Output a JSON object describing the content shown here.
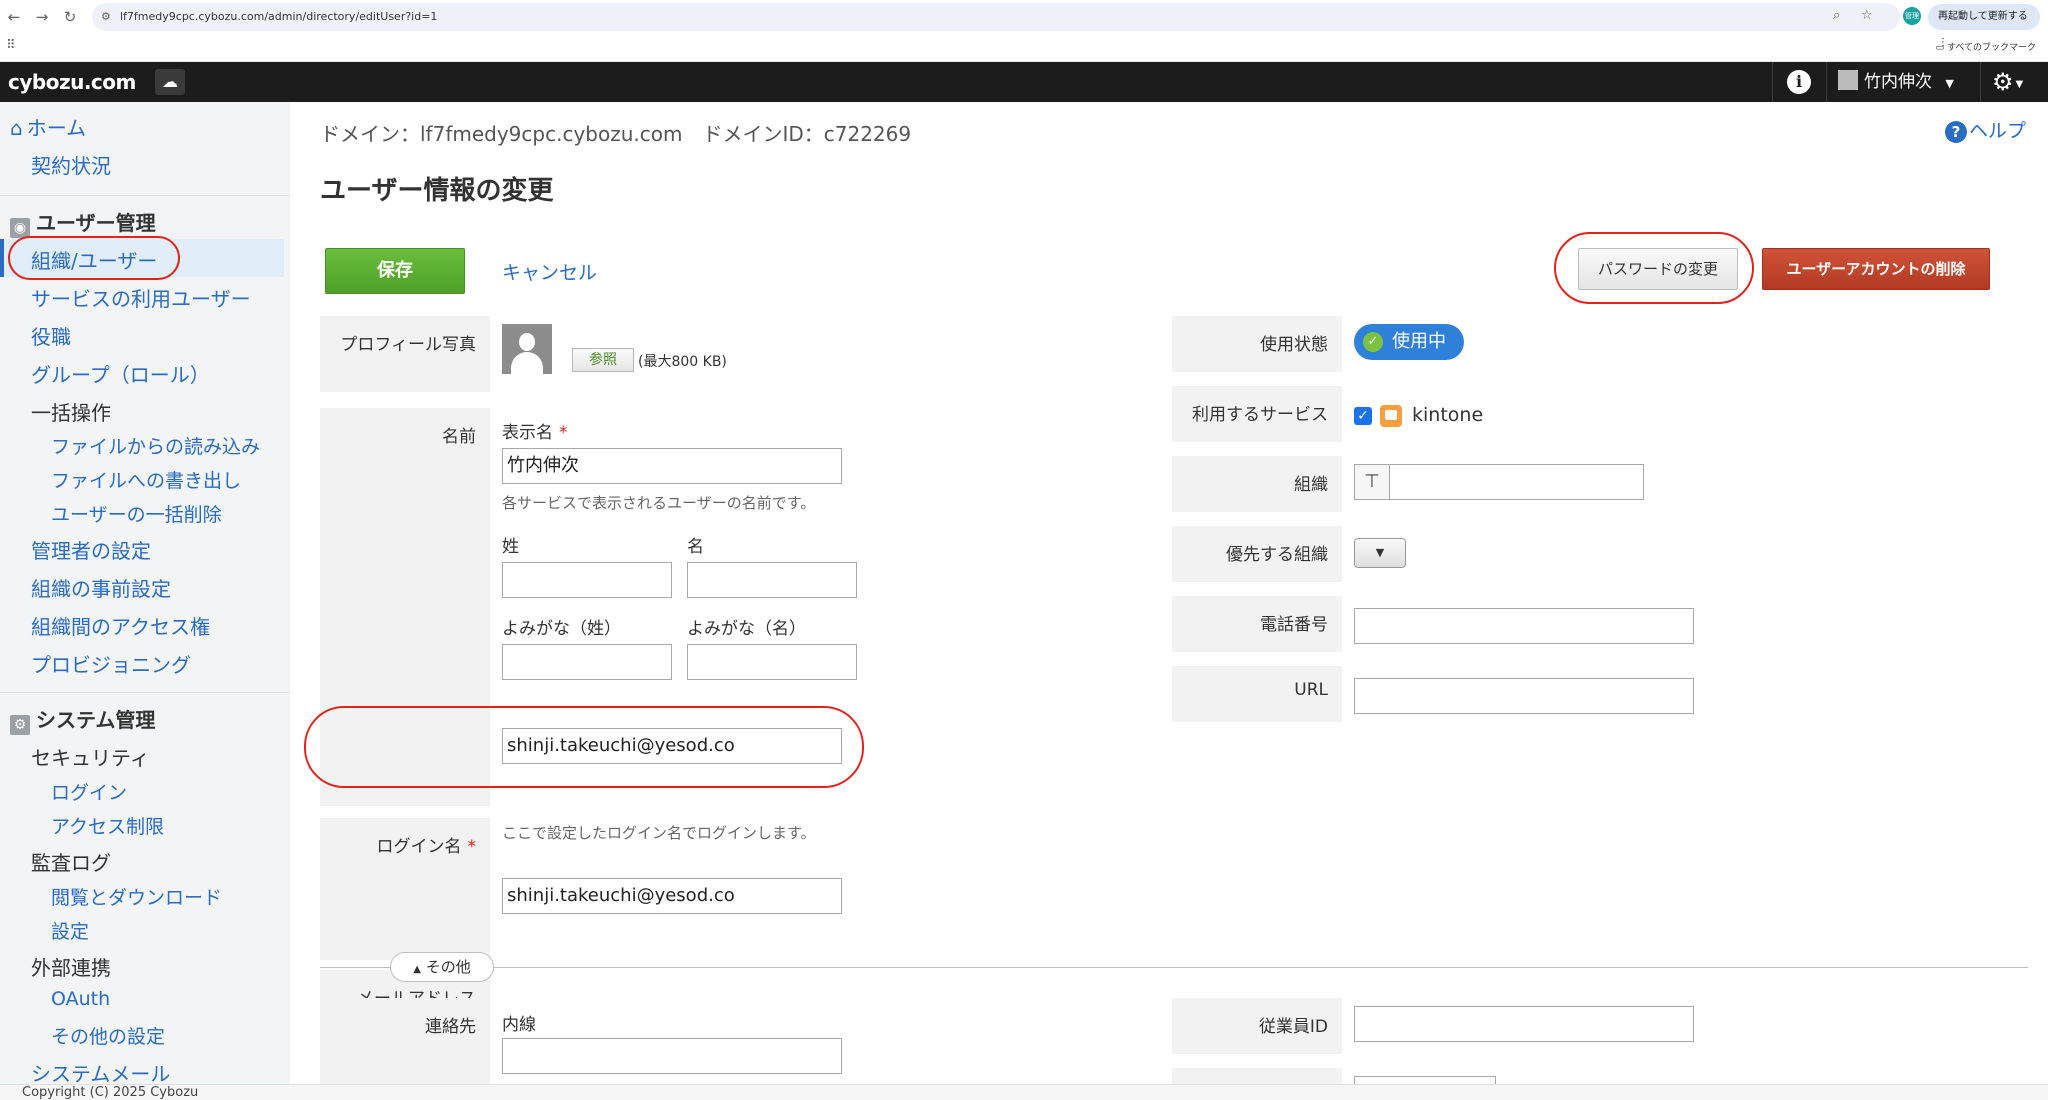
{
  "browser": {
    "url": "lf7fmedy9cpc.cybozu.com/admin/directory/editUser?id=1",
    "profile_label": "管理",
    "relaunch_label": "再起動して更新する",
    "bookmarks_label": "すべてのブックマーク"
  },
  "header": {
    "logo": "cybozu.com",
    "user_name": "竹内伸次"
  },
  "sidebar": {
    "home": "ホーム",
    "contract": "契約状況",
    "user_mgmt_title": "ユーザー管理",
    "user_mgmt_items": [
      "組織/ユーザー",
      "サービスの利用ユーザー",
      "役職",
      "グループ（ロール）"
    ],
    "bulk_title": "一括操作",
    "bulk_items": [
      "ファイルからの読み込み",
      "ファイルへの書き出し",
      "ユーザーの一括削除"
    ],
    "more_items": [
      "管理者の設定",
      "組織の事前設定",
      "組織間のアクセス権",
      "プロビジョニング"
    ],
    "system_title": "システム管理",
    "security_title": "セキュリティ",
    "security_items": [
      "ログイン",
      "アクセス制限"
    ],
    "audit_title": "監査ログ",
    "audit_items": [
      "閲覧とダウンロード",
      "設定"
    ],
    "external_title": "外部連携",
    "external_items": [
      "OAuth",
      "その他の設定"
    ],
    "system_mail": "システムメール"
  },
  "footer": {
    "copyright": "Copyright (C) 2025 Cybozu"
  },
  "main": {
    "domain_info": "ドメイン：lf7fmedy9cpc.cybozu.com　ドメインID：c722269",
    "help": "ヘルプ",
    "title": "ユーザー情報の変更",
    "save": "保存",
    "cancel": "キャンセル",
    "change_password": "パスワードの変更",
    "delete_account": "ユーザーアカウントの削除",
    "profile_photo_label": "プロフィール写真",
    "browse": "参照",
    "max_size": "(最大800 KB)",
    "name_label": "名前",
    "display_name_label": "表示名",
    "display_name_value": "竹内伸次",
    "display_name_hint": "各サービスで表示されるユーザーの名前です。",
    "last_name_label": "姓",
    "first_name_label": "名",
    "last_name_kana_label": "よみがな（姓）",
    "first_name_kana_label": "よみがな（名）",
    "login_label": "ログイン名",
    "login_value": "shinji.takeuchi@yesod.co",
    "login_hint": "ここで設定したログイン名でログインします。",
    "email_label": "メールアドレス",
    "email_value": "shinji.takeuchi@yesod.co",
    "more_toggle": "その他",
    "contact_label": "連絡先",
    "extension_label": "内線",
    "status_label": "使用状態",
    "status_value": "使用中",
    "services_label": "利用するサービス",
    "service_name": "kintone",
    "org_label": "組織",
    "priority_org_label": "優先する組織",
    "phone_label": "電話番号",
    "url_label": "URL",
    "employee_id_label": "従業員ID"
  },
  "colors": {
    "accent": "#2a6cc4",
    "save": "#5aaf30",
    "delete": "#c0462d",
    "annotation": "#e2231a"
  }
}
